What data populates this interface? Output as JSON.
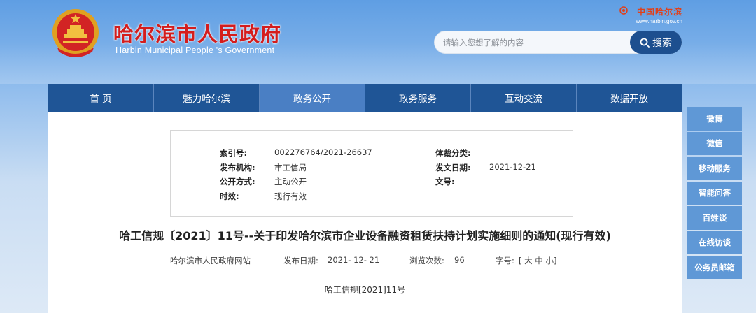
{
  "header": {
    "title": "哈尔滨市人民政府",
    "subtitle": "Harbin Municipal People 's Government",
    "top_logo_text": "中国哈尔滨",
    "top_logo_url": "www.harbin.gov.cn"
  },
  "search": {
    "placeholder": "请输入您想了解的内容",
    "button_label": "搜索"
  },
  "nav": {
    "items": [
      {
        "label": "首 页"
      },
      {
        "label": "魅力哈尔滨"
      },
      {
        "label": "政务公开"
      },
      {
        "label": "政务服务"
      },
      {
        "label": "互动交流"
      },
      {
        "label": "数据开放"
      }
    ],
    "active_index": 2
  },
  "meta": {
    "index_label": "索引号:",
    "index_value": "002276764/2021-26637",
    "genre_label": "体裁分类:",
    "genre_value": "",
    "publisher_label": "发布机构:",
    "publisher_value": "市工信局",
    "date_label": "发文日期:",
    "date_value": "2021-12-21",
    "mode_label": "公开方式:",
    "mode_value": "主动公开",
    "docno_label": "文号:",
    "docno_value": "",
    "validity_label": "时效:",
    "validity_value": "现行有效"
  },
  "article": {
    "title": "哈工信规〔2021〕11号--关于印发哈尔滨市企业设备融资租赁扶持计划实施细则的通知(现行有效)",
    "source": "哈尔滨市人民政府网站",
    "publish_label": "发布日期:",
    "publish_value": "2021- 12- 21",
    "views_label": "浏览次数:",
    "views_value": "96",
    "font_label": "字号:",
    "font_options": "[ 大 中 小]",
    "doc_number": "哈工信规[2021]11号"
  },
  "side_bar": {
    "items": [
      {
        "label": "微博"
      },
      {
        "label": "微信"
      },
      {
        "label": "移动服务"
      },
      {
        "label": "智能问答"
      },
      {
        "label": "百姓谈"
      },
      {
        "label": "在线访谈"
      },
      {
        "label": "公务员邮箱"
      }
    ]
  },
  "colors": {
    "nav_bg": "#1f5596",
    "nav_active": "#4a7fc4",
    "title_red": "#d41d1d",
    "side_bg": "#5f98d6",
    "search_btn": "#1d4f8f"
  }
}
